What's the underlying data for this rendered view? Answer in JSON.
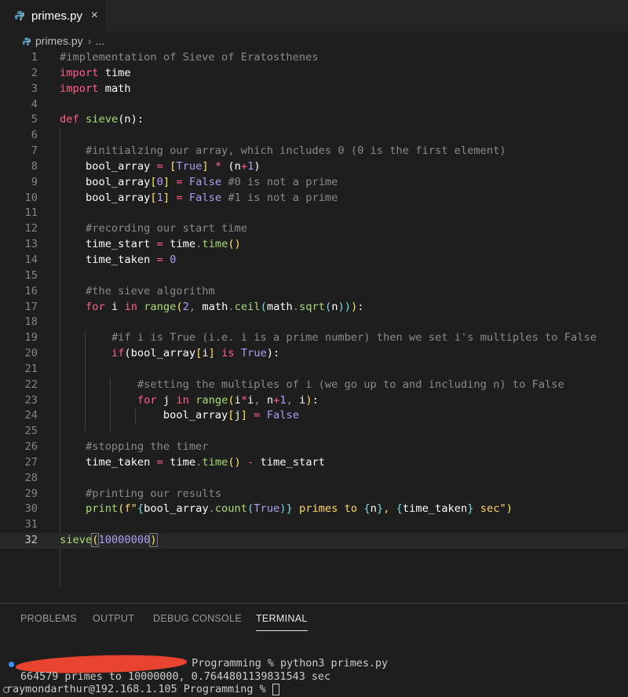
{
  "tab": {
    "label": "primes.py",
    "close": "×"
  },
  "breadcrumb": {
    "file": "primes.py",
    "rest": "..."
  },
  "panel": {
    "tabs": [
      "PROBLEMS",
      "OUTPUT",
      "DEBUG CONSOLE",
      "TERMINAL"
    ],
    "active": "TERMINAL"
  },
  "terminal": {
    "line1_visible": "   Programming % python3 primes.py",
    "line2": "664579 primes to 10000000, 0.7644801139831543 sec",
    "line3": "raymondarthur@192.168.1.105 Programming % "
  },
  "colors": {
    "keyword": "#ff6188",
    "function": "#a9dc76",
    "constant": "#ab9df2",
    "comment": "#8a8a8a"
  },
  "icons": {
    "file": "python-icon"
  }
}
